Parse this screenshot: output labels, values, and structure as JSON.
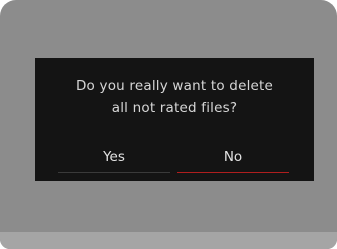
{
  "dialog": {
    "message_line1": "Do you really want to delete",
    "message_line2": "all not rated files?",
    "yes_label": "Yes",
    "no_label": "No",
    "selected_option": "No"
  },
  "colors": {
    "screen_background": "#8c8c8c",
    "dialog_background": "#141414",
    "text": "#d6d6d6",
    "selection_underline": "#b01e1e",
    "inactive_underline": "#3a3a3a"
  }
}
